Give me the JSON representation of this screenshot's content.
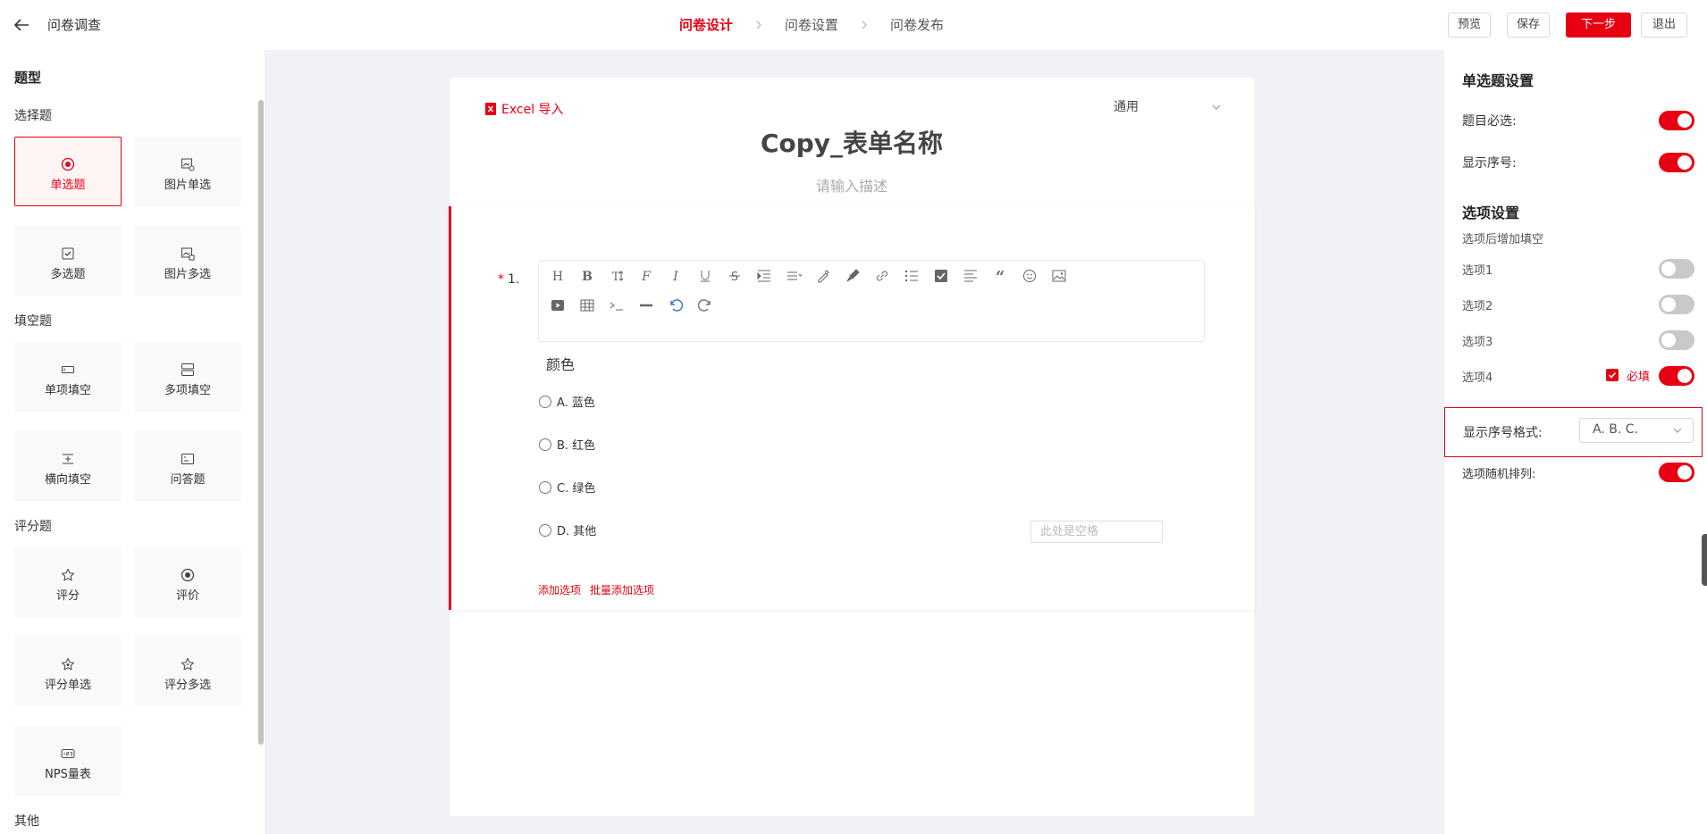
{
  "header": {
    "back_label": "←",
    "title": "问卷调查",
    "steps": [
      "问卷设计",
      "问卷设置",
      "问卷发布"
    ],
    "active_step": "问卷设计",
    "buttons": {
      "preview": "预览",
      "save": "保存",
      "next": "下一步",
      "exit": "退出"
    }
  },
  "sidebar": {
    "heading": "题型",
    "groups": [
      {
        "title": "选择题",
        "items": [
          {
            "label": "单选题",
            "icon": "radio-icon",
            "active": true
          },
          {
            "label": "图片单选",
            "icon": "image-radio-icon"
          },
          {
            "label": "多选题",
            "icon": "checkbox-icon"
          },
          {
            "label": "图片多选",
            "icon": "image-checkbox-icon"
          }
        ]
      },
      {
        "title": "填空题",
        "items": [
          {
            "label": "单项填空",
            "icon": "single-blank-icon"
          },
          {
            "label": "多项填空",
            "icon": "multi-blank-icon"
          },
          {
            "label": "横向填空",
            "icon": "horizontal-blank-icon"
          },
          {
            "label": "问答题",
            "icon": "essay-icon"
          }
        ]
      },
      {
        "title": "评分题",
        "items": [
          {
            "label": "评分",
            "icon": "star-icon"
          },
          {
            "label": "评价",
            "icon": "evaluate-icon"
          },
          {
            "label": "评分单选",
            "icon": "star-radio-icon"
          },
          {
            "label": "评分多选",
            "icon": "stars-icon"
          },
          {
            "label": "NPS量表",
            "icon": "nps-icon"
          }
        ]
      },
      {
        "title": "其他",
        "items": []
      }
    ]
  },
  "form": {
    "excel_import": "Excel 导入",
    "category": "通用",
    "title": "Copy_表单名称",
    "description_placeholder": "请输入描述",
    "question": {
      "required_mark": "*",
      "number": "1.",
      "text": "颜色",
      "options": [
        "A. 蓝色",
        "B. 红色",
        "C. 绿色",
        "D. 其他"
      ],
      "blank_placeholder": "此处是空格",
      "add_option": "添加选项",
      "bulk_add_option": "批量添加选项"
    },
    "toolbar_icons": [
      "heading-icon",
      "bold-icon",
      "font-size-icon",
      "font-family-icon",
      "italic-icon",
      "underline-icon",
      "strikethrough-icon",
      "indent-icon",
      "line-height-icon",
      "font-color-icon",
      "background-color-icon",
      "link-icon",
      "bullet-list-icon",
      "todo-list-icon",
      "justify-icon",
      "quote-icon",
      "emoji-icon",
      "image-icon",
      "video-icon",
      "table-icon",
      "code-icon",
      "divider-icon",
      "undo-icon",
      "redo-icon"
    ]
  },
  "settings": {
    "title": "单选题设置",
    "required_label": "题目必选:",
    "required_on": true,
    "show_number_label": "显示序号:",
    "show_number_on": true,
    "options_title": "选项设置",
    "options_subtitle": "选项后增加填空",
    "option_fill": [
      {
        "label": "选项1",
        "on": false
      },
      {
        "label": "选项2",
        "on": false
      },
      {
        "label": "选项3",
        "on": false
      },
      {
        "label": "选项4",
        "on": true,
        "required_checked": true,
        "required_label": "必填"
      }
    ],
    "number_format_label": "显示序号格式:",
    "number_format_value": "A. B. C.",
    "random_label": "选项随机排列:",
    "random_on": true
  },
  "colors": {
    "accent": "#e60012",
    "canvas": "#f0f2f5"
  }
}
